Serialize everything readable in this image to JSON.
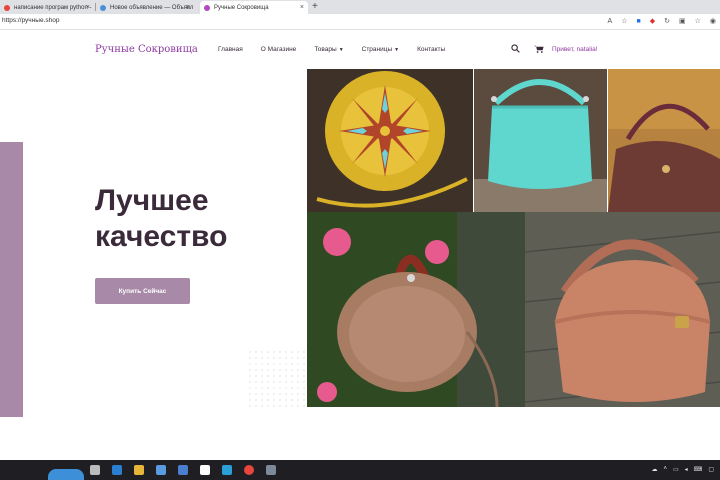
{
  "browser": {
    "tabs": [
      {
        "label": "написание програм python -"
      },
      {
        "label": "Новое объявление — Объявл"
      },
      {
        "label": "Ручные Сокровища"
      }
    ],
    "url": "https://ручные.shop"
  },
  "site": {
    "logo": "Ручные Сокровища",
    "nav": {
      "home": "Главная",
      "about": "О Магазине",
      "products": "Товары",
      "pages": "Страницы",
      "contacts": "Контакты"
    },
    "greeting": "Привет, natalia!"
  },
  "hero": {
    "headline_line1": "Лучшее",
    "headline_line2": "качество",
    "cta_label": "Купить Сейчас"
  },
  "colors": {
    "accent": "#8e3aa0",
    "button": "#a88aa8",
    "headline": "#3a2a3a",
    "taskbar": "#1f1f23"
  },
  "icons": {
    "search": "search-icon",
    "cart": "cart-icon"
  }
}
